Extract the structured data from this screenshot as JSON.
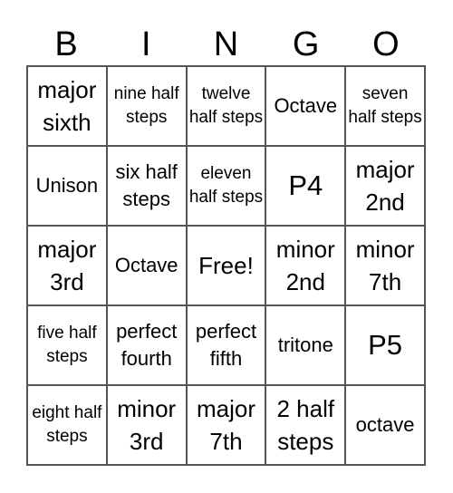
{
  "header": {
    "letters": [
      "B",
      "I",
      "N",
      "G",
      "O"
    ]
  },
  "cells": [
    {
      "text": "major sixth",
      "size": "m"
    },
    {
      "text": "nine half steps",
      "size": "s"
    },
    {
      "text": "twelve half steps",
      "size": "s"
    },
    {
      "text": "Octave",
      "size": "r"
    },
    {
      "text": "seven half steps",
      "size": "s"
    },
    {
      "text": "Unison",
      "size": "r"
    },
    {
      "text": "six half steps",
      "size": "r"
    },
    {
      "text": "eleven half steps",
      "size": "s"
    },
    {
      "text": "P4",
      "size": "l"
    },
    {
      "text": "major 2nd",
      "size": "m"
    },
    {
      "text": "major 3rd",
      "size": "m"
    },
    {
      "text": "Octave",
      "size": "r"
    },
    {
      "text": "Free!",
      "size": "m"
    },
    {
      "text": "minor 2nd",
      "size": "m"
    },
    {
      "text": "minor 7th",
      "size": "m"
    },
    {
      "text": "five half steps",
      "size": "s"
    },
    {
      "text": "perfect fourth",
      "size": "r"
    },
    {
      "text": "perfect fifth",
      "size": "r"
    },
    {
      "text": "tritone",
      "size": "r"
    },
    {
      "text": "P5",
      "size": "l"
    },
    {
      "text": "eight half steps",
      "size": "s"
    },
    {
      "text": "minor 3rd",
      "size": "m"
    },
    {
      "text": "major 7th",
      "size": "m"
    },
    {
      "text": "2 half steps",
      "size": "m"
    },
    {
      "text": "octave",
      "size": "r"
    }
  ]
}
